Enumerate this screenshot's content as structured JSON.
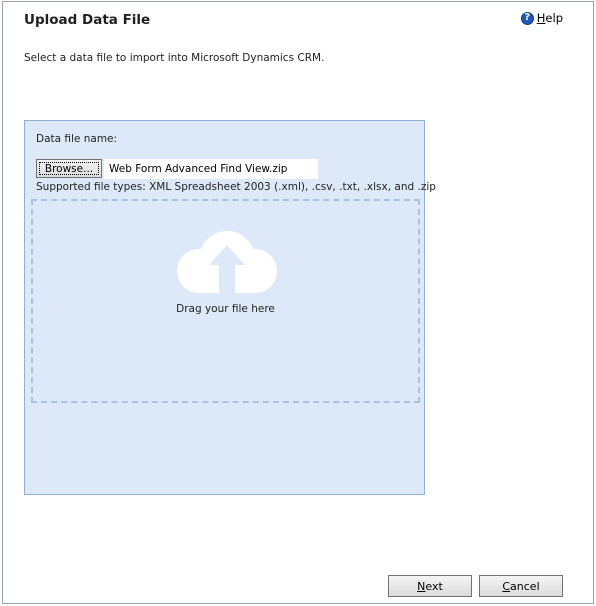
{
  "dialog": {
    "title": "Upload Data File",
    "help": {
      "icon": "help-icon",
      "glyph": "?",
      "label": "Help"
    },
    "instructions": "Select a data file to import into Microsoft Dynamics CRM."
  },
  "upload": {
    "field_label": "Data file name:",
    "browse_label": "Browse...",
    "file_name": "Web Form Advanced Find View.zip",
    "supported_types": "Supported file types: XML Spreadsheet 2003 (.xml), .csv, .txt, .xlsx, and .zip",
    "drop_icon": "cloud-upload-icon",
    "drop_text": "Drag your file here"
  },
  "buttons": {
    "next_label": "Next",
    "cancel_label": "Cancel"
  },
  "colors": {
    "panel_background": "#dde9f8",
    "panel_border": "#8fb0d8",
    "drop_zone_border": "#a9c2e2",
    "help_icon": "#1e5ab7"
  }
}
